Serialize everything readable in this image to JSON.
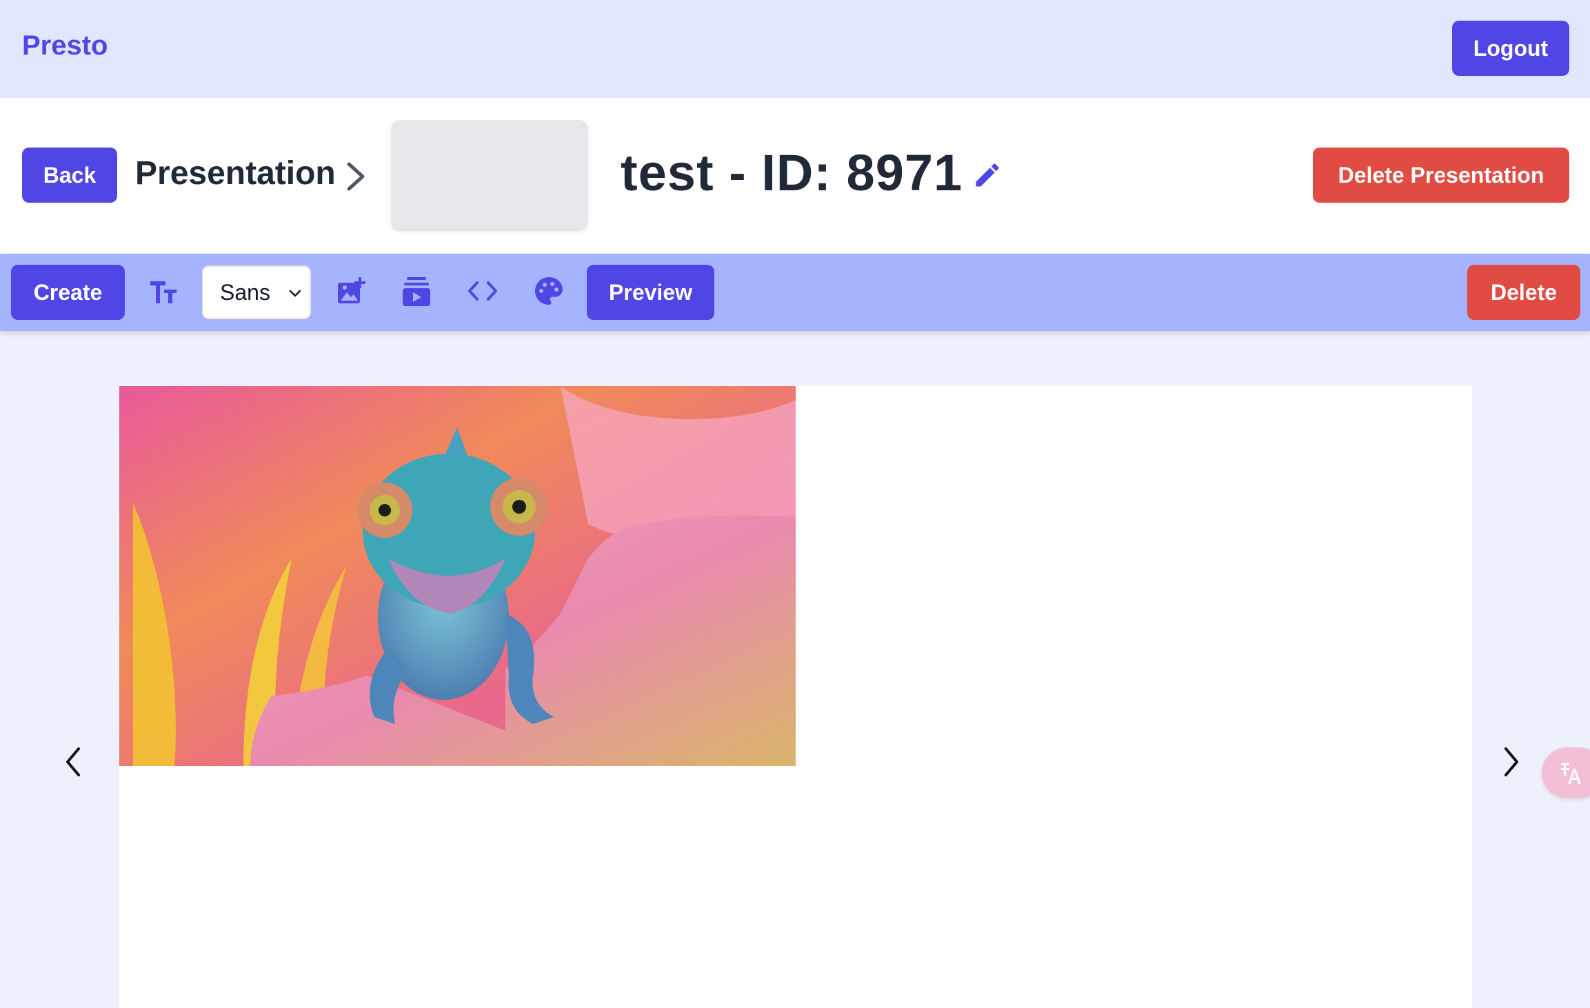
{
  "app": {
    "brand": "Presto",
    "logout_label": "Logout"
  },
  "header": {
    "back_label": "Back",
    "breadcrumb": "Presentation",
    "title": "test - ID: 8971",
    "delete_presentation_label": "Delete Presentation"
  },
  "toolbar": {
    "create_label": "Create",
    "font_selected": "Sans",
    "preview_label": "Preview",
    "delete_label": "Delete",
    "icons": [
      "text-size-icon",
      "add-image-icon",
      "add-video-icon",
      "code-icon",
      "palette-icon"
    ]
  },
  "slide": {
    "image_subject": "chameleon-on-flower-image"
  },
  "colors": {
    "accent": "#4f46e5",
    "danger": "#e04b43",
    "topbar": "#e0e7ff",
    "toolbar": "#a5b4fc",
    "canvas_bg": "#eef0fc"
  }
}
